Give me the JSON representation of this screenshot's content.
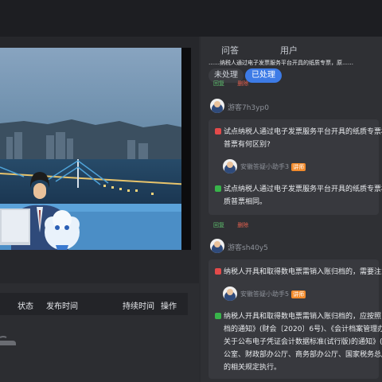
{
  "tabs": [
    "问答",
    "用户"
  ],
  "filter": {
    "unprocessed": "未处理",
    "processed": "已处理"
  },
  "top_partial": "……纳税人通过电子发票服务平台开具的纸质专票，原……",
  "actions": {
    "reply": "回复",
    "delete": "删除"
  },
  "table_headers": [
    "状态",
    "发布时间",
    "持续时间",
    "操作"
  ],
  "threads": [
    {
      "user": "游客7h3yp0",
      "question_lines": [
        "试点纳税人通过电子发票服务平台开具的纸质专票相",
        "普票有何区别?"
      ],
      "helper": "安徽答疑小助手3",
      "badge": "讲师",
      "answer_lines": [
        "试点纳税人通过电子发票服务平台开具的纸质专票相",
        "质普票相同。"
      ]
    },
    {
      "user": "游客sh40y5",
      "question_lines": [
        "纳税人开具和取得数电票需销入账归档的，需要注意"
      ],
      "helper": "安徽答疑小助手5",
      "badge": "讲师",
      "answer_lines": [
        "纳税人开具和取得数电票需销入账归档的，应按照",
        "档的通知》(财会〔2020〕6号)、《会计档案管理办",
        "关于公布电子凭证会计数据标准(试行版)的通知》(财",
        "公室、财政部办公厅、商务部办公厅、国家税务总局",
        "的相关规定执行。"
      ]
    }
  ],
  "colors": {
    "accent": "#3d7be6",
    "reply": "#5ec06e",
    "delete": "#e2604f",
    "question_tag": "#e34a4a",
    "answer_tag": "#38b44a",
    "badge": "#f28b2c"
  }
}
